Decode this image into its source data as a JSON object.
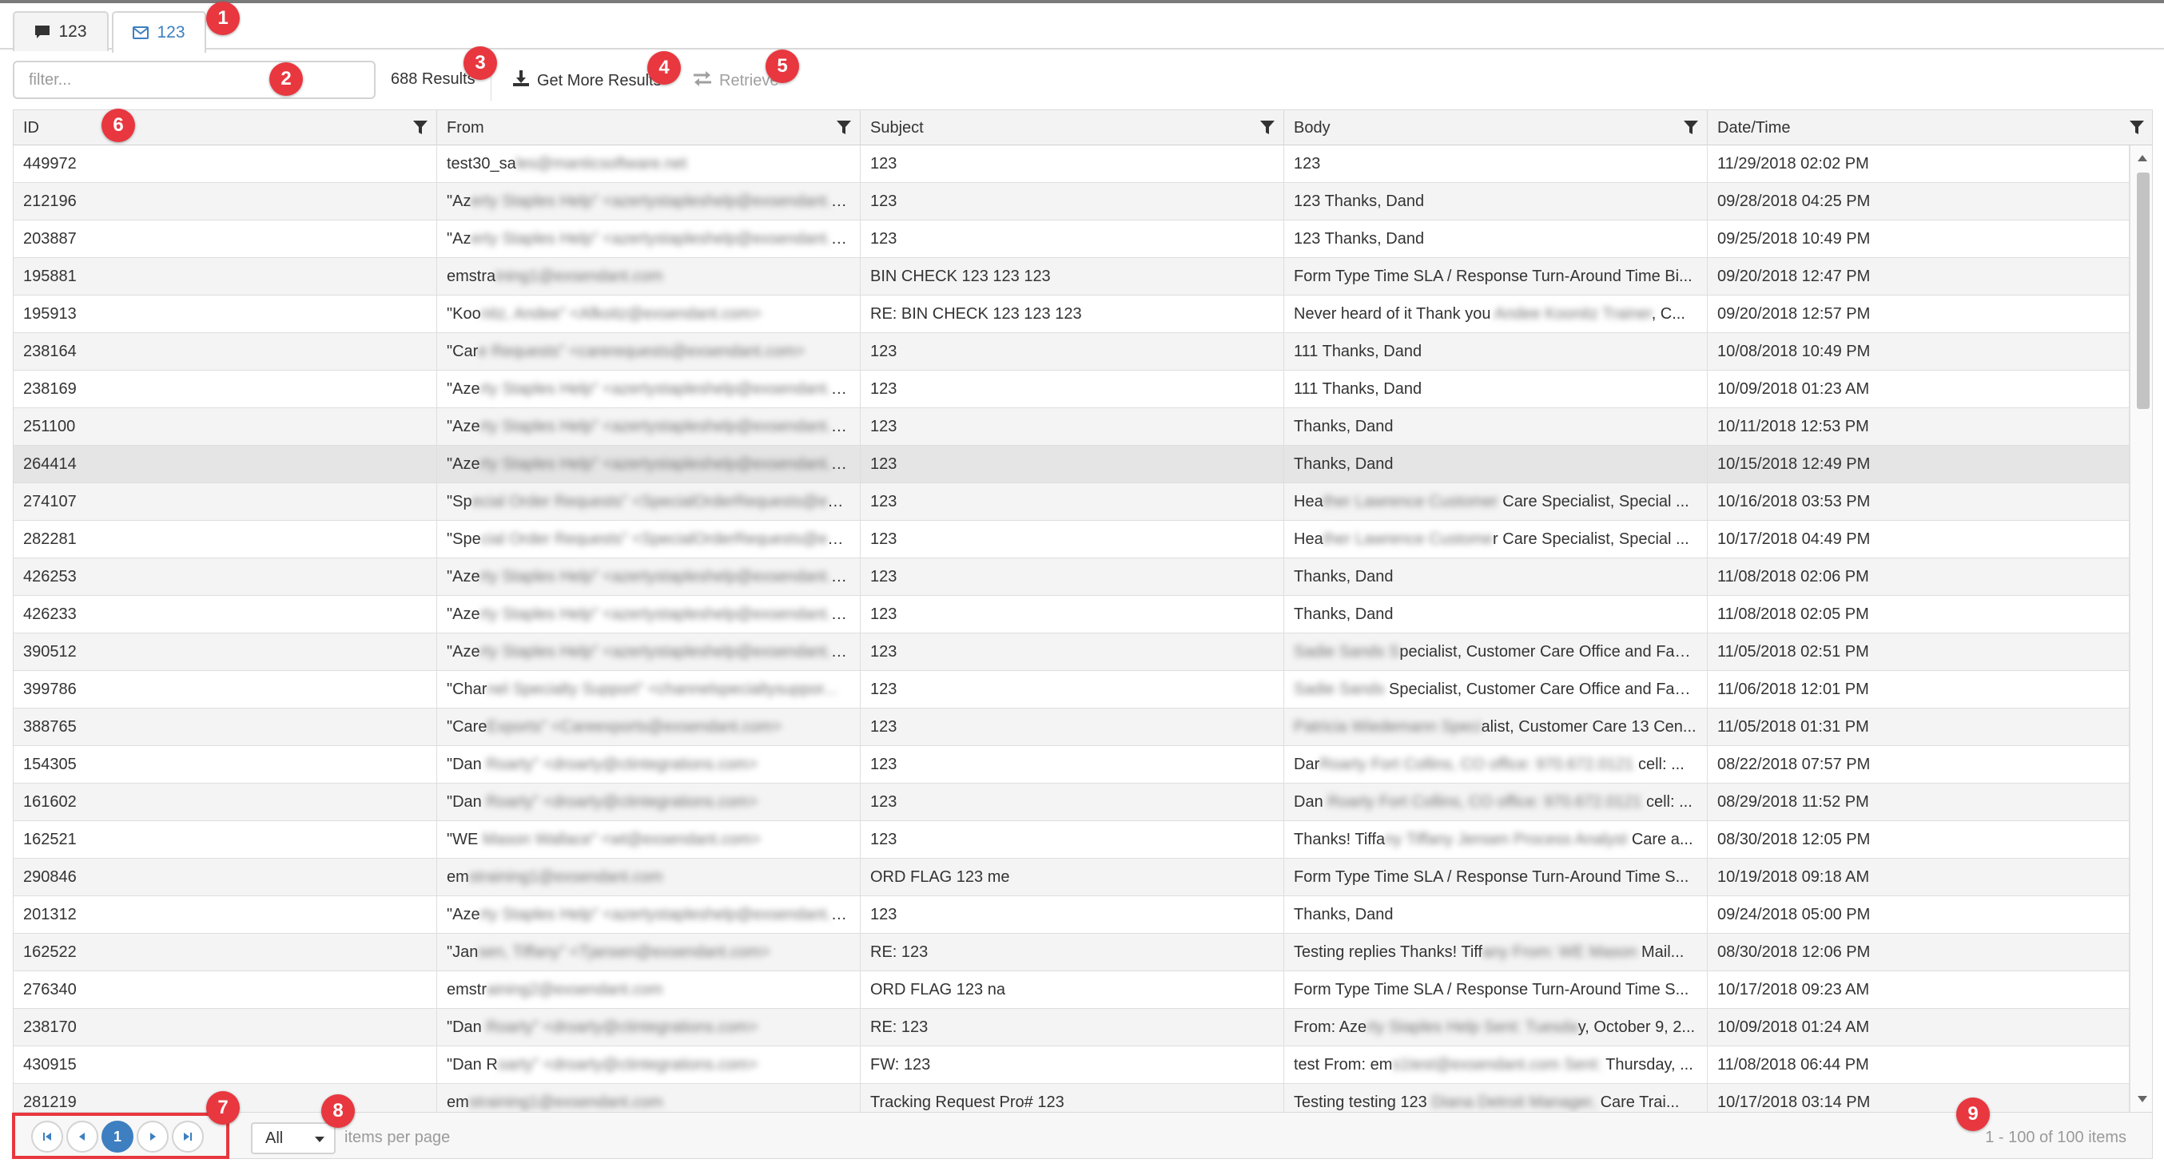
{
  "tabs": [
    {
      "label": "123",
      "icon": "comment-icon",
      "active": false
    },
    {
      "label": "123",
      "icon": "envelope-icon",
      "active": true
    }
  ],
  "toolbar": {
    "filter_placeholder": "filter...",
    "results_text": "688 Results",
    "get_more_label": "Get More Results",
    "retrieve_label": "Retrieve"
  },
  "grid": {
    "columns": [
      "ID",
      "From",
      "Subject",
      "Body",
      "Date/Time"
    ],
    "rows": [
      {
        "id": "449972",
        "from": "test30_sa",
        "from_blur": "les@manticsoftware.net",
        "subject": "123",
        "body": "123",
        "body_blur": "",
        "body_tail": "",
        "date": "11/29/2018 02:02 PM"
      },
      {
        "id": "212196",
        "from": "\"Az",
        "from_blur": "erty Staples Help\" <azertystapleshelp@exsendant.c...",
        "subject": "123",
        "body": "123 Thanks, Dand",
        "body_blur": "",
        "body_tail": "",
        "date": "09/28/2018 04:25 PM"
      },
      {
        "id": "203887",
        "from": "\"Az",
        "from_blur": "erty Staples Help\" <azertystapleshelp@exsendant.c...",
        "subject": "123",
        "body": "123 Thanks, Dand",
        "body_blur": "",
        "body_tail": "",
        "date": "09/25/2018 10:49 PM"
      },
      {
        "id": "195881",
        "from": "emstra",
        "from_blur": "ining1@exsendant.com",
        "subject": "BIN CHECK 123 123 123",
        "body": "Form Type Time SLA / Response Turn-Around Time Bi...",
        "body_blur": "",
        "body_tail": "",
        "date": "09/20/2018 12:47 PM"
      },
      {
        "id": "195913",
        "from": "\"Koo",
        "from_blur": "nitz, Andee\" <Afkoitz@exsendant.com>",
        "subject": "RE: BIN CHECK 123 123 123",
        "body": "Never heard of it Thank you",
        "body_blur": " Andee Koonitz Trainer",
        "body_tail": ", C...",
        "date": "09/20/2018 12:57 PM"
      },
      {
        "id": "238164",
        "from": "\"Car",
        "from_blur": "e Requests\" <carerequests@exsendant.com>",
        "subject": "123",
        "body": "111 Thanks, Dand",
        "body_blur": "",
        "body_tail": "",
        "date": "10/08/2018 10:49 PM"
      },
      {
        "id": "238169",
        "from": "\"Aze",
        "from_blur": "rty Staples Help\" <azertystapleshelp@exsendant.c...",
        "subject": "123",
        "body": "111 Thanks, Dand",
        "body_blur": "",
        "body_tail": "",
        "date": "10/09/2018 01:23 AM"
      },
      {
        "id": "251100",
        "from": "\"Aze",
        "from_blur": "rty Staples Help\" <azertystapleshelp@exsendant.c...",
        "subject": "123",
        "body": "Thanks, Dand",
        "body_blur": "",
        "body_tail": "",
        "date": "10/11/2018 12:53 PM"
      },
      {
        "id": "264414",
        "from": "\"Aze",
        "from_blur": "rty Staples Help\" <azertystapleshelp@exsendant.c...",
        "subject": "123",
        "body": "Thanks, Dand",
        "body_blur": "",
        "body_tail": "",
        "date": "10/15/2018 12:49 PM"
      },
      {
        "id": "274107",
        "from": "\"Sp",
        "from_blur": "ecial Order Requests\" <SpecialOrderRequests@exs...",
        "subject": "123",
        "body": "Hea",
        "body_blur": "ther Lawrence Customer",
        "body_tail": " Care Specialist, Special ...",
        "date": "10/16/2018 03:53 PM"
      },
      {
        "id": "282281",
        "from": "\"Spe",
        "from_blur": "cial Order Requests\" <SpecialOrderRequests@exs...",
        "subject": "123",
        "body": "Hea",
        "body_blur": "ther Lawrence Custome",
        "body_tail": "r Care Specialist, Special ...",
        "date": "10/17/2018 04:49 PM"
      },
      {
        "id": "426253",
        "from": "\"Aze",
        "from_blur": "rty Staples Help\" <azertystapleshelp@exsendant.c...",
        "subject": "123",
        "body": "Thanks, Dand",
        "body_blur": "",
        "body_tail": "",
        "date": "11/08/2018 02:06 PM"
      },
      {
        "id": "426233",
        "from": "\"Aze",
        "from_blur": "rty Staples Help\" <azertystapleshelp@exsendant.c...",
        "subject": "123",
        "body": "Thanks, Dand",
        "body_blur": "",
        "body_tail": "",
        "date": "11/08/2018 02:05 PM"
      },
      {
        "id": "390512",
        "from": "\"Aze",
        "from_blur": "rty Staples Help\" <azertystapleshelp@exsendant.c...",
        "subject": "123",
        "body": "",
        "body_blur": "Sadie Sands S",
        "body_tail": "pecialist, Customer Care Office and Facil...",
        "date": "11/05/2018 02:51 PM"
      },
      {
        "id": "399786",
        "from": "\"Char",
        "from_blur": "nel Specialty Support\" <channelspecialtysuppor...",
        "subject": "123",
        "body": "",
        "body_blur": "Sadie Sands ",
        "body_tail": "Specialist, Customer Care Office and Facil...",
        "date": "11/06/2018 12:01 PM"
      },
      {
        "id": "388765",
        "from": "\"Care",
        "from_blur": "Exports\" <Careexports@exsendant.com>",
        "subject": "123",
        "body": "",
        "body_blur": "Patricia Wiedemann Speci",
        "body_tail": "alist, Customer Care 13 Cen...",
        "date": "11/05/2018 01:31 PM"
      },
      {
        "id": "154305",
        "from": "\"Dan ",
        "from_blur": "Roarty\" <droarty@ctintegrations.com>",
        "subject": "123",
        "body": "Dar",
        "body_blur": "Roarty Fort Collins, CO office: 970.672.0121",
        "body_tail": " cell: ...",
        "date": "08/22/2018 07:57 PM"
      },
      {
        "id": "161602",
        "from": "\"Dan ",
        "from_blur": "Roarty\" <droarty@ctintegrations.com>",
        "subject": "123",
        "body": "Dan",
        "body_blur": " Roarty Fort Collins, CO office: 970.672.0121",
        "body_tail": " cell: ...",
        "date": "08/29/2018 11:52 PM"
      },
      {
        "id": "162521",
        "from": "\"WE",
        "from_blur": " Mason Wallace\" <wt@exsendant.com>",
        "subject": "123",
        "body": "Thanks! Tiffa",
        "body_blur": "ny Tiffany Jensen Process Analyst",
        "body_tail": " Care a...",
        "date": "08/30/2018 12:05 PM"
      },
      {
        "id": "290846",
        "from": "em",
        "from_blur": "straining1@exsendant.com",
        "subject": "ORD FLAG 123 me",
        "body": "Form Type Time SLA / Response Turn-Around Time S...",
        "body_blur": "",
        "body_tail": "",
        "date": "10/19/2018 09:18 AM"
      },
      {
        "id": "201312",
        "from": "\"Aze",
        "from_blur": "rty Staples Help\" <azertystapleshelp@exsendant.c...",
        "subject": "123",
        "body": "Thanks, Dand",
        "body_blur": "",
        "body_tail": "",
        "date": "09/24/2018 05:00 PM"
      },
      {
        "id": "162522",
        "from": "\"Jan",
        "from_blur": "sen, Tiffany\" <Tjansen@exsendant.com>",
        "subject": "RE: 123",
        "body": "Testing replies Thanks! Tiff",
        "body_blur": "any From: WE Mason",
        "body_tail": " Mail...",
        "date": "08/30/2018 12:06 PM"
      },
      {
        "id": "276340",
        "from": "emstr",
        "from_blur": "aining2@exsendant.com",
        "subject": "ORD FLAG 123 na",
        "body": "Form Type Time SLA / Response Turn-Around Time S...",
        "body_blur": "",
        "body_tail": "",
        "date": "10/17/2018 09:23 AM"
      },
      {
        "id": "238170",
        "from": "\"Dan",
        "from_blur": " Roarty\" <droarty@ctintegrations.com>",
        "subject": "RE: 123",
        "body": "From: Aze",
        "body_blur": "rty Staples Help Sent: Tuesda",
        "body_tail": "y, October 9, 2...",
        "date": "10/09/2018 01:24 AM"
      },
      {
        "id": "430915",
        "from": "\"Dan R",
        "from_blur": "oarty\" <droarty@ctintegrations.com>",
        "subject": "FW: 123",
        "body": "test From: em",
        "body_blur": "s1test@exsendant.com Sent:",
        "body_tail": " Thursday, ...",
        "date": "11/08/2018 06:44 PM"
      },
      {
        "id": "281219",
        "from": "em",
        "from_blur": "straining1@exsendant.com",
        "subject": "Tracking Request Pro# 123",
        "body": "Testing testing 123",
        "body_blur": " Diana Detroit Manager,",
        "body_tail": " Care Trai...",
        "date": "10/17/2018 03:14 PM"
      }
    ]
  },
  "pager": {
    "current_page": "1",
    "page_size": "All",
    "items_per_page_label": "items per page",
    "range_text": "1 - 100 of 100 items"
  },
  "callouts": [
    "1",
    "2",
    "3",
    "4",
    "5",
    "6",
    "7",
    "8",
    "9"
  ],
  "colors": {
    "accent": "#3d7fc1",
    "callout": "#e8373f",
    "header_bg": "#f3f3f3",
    "alt_row_bg": "#f4f4f4"
  }
}
